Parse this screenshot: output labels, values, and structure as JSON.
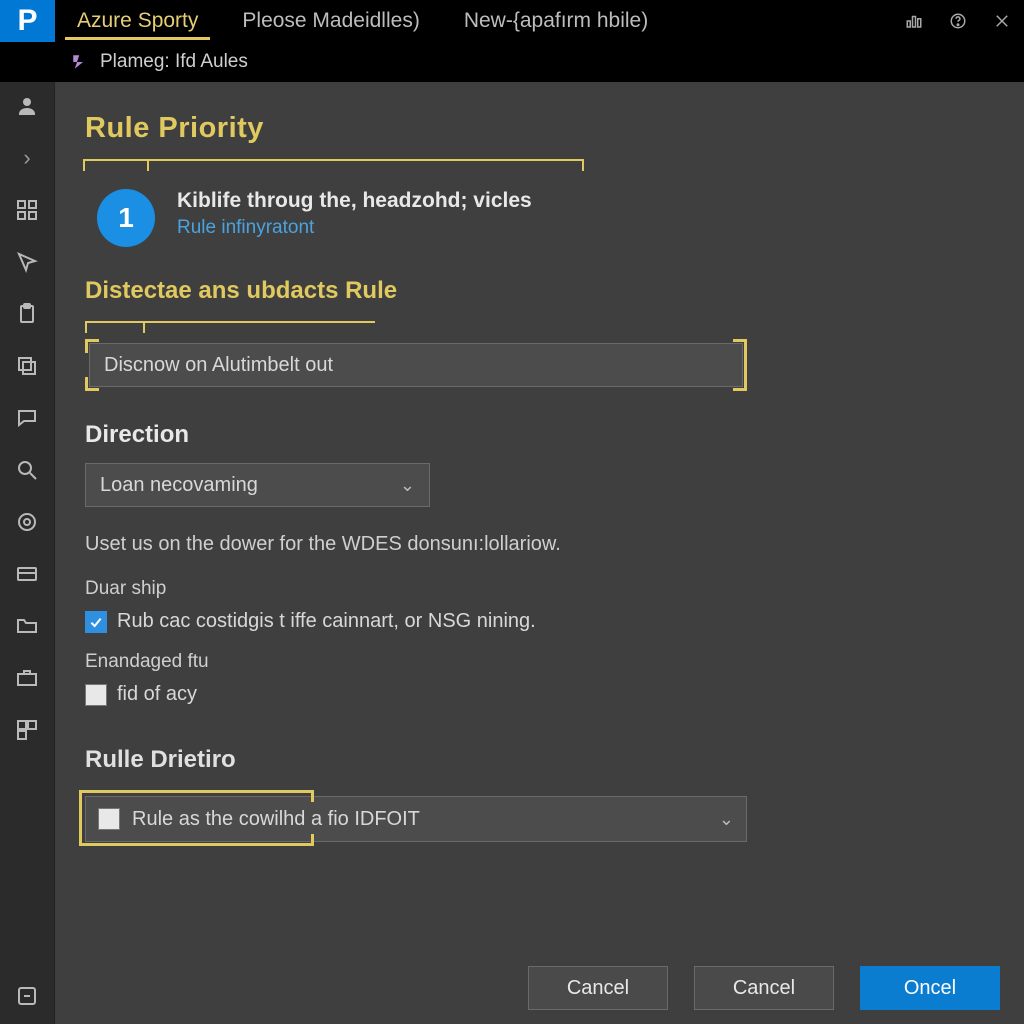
{
  "tabs": {
    "t0": "Azure Sporty",
    "t1": "Pleose Madeidlles)",
    "t2": "New-{apafırm  hbile)"
  },
  "breadcrumb": {
    "label": "Plameg: Ifd Aules"
  },
  "sections": {
    "priority_title": "Rule Priority",
    "priority_item_text": "Kiblife throug the, headzohd; vicles",
    "priority_item_link": "Rule infinyratont",
    "priority_badge": "1",
    "dist_title": "Distectae ans ubdacts Rule",
    "dist_input": "Discnow on Alutimbelt out",
    "direction_title": "Direction",
    "direction_selected": "Loan necovaming",
    "helper": "Uset us on the dower for the WDES donsunı:lollariow.",
    "group1_label": "Duar ship",
    "check1_label": "Rub cac costidgis t iffe cainnart, or NSG nining.",
    "group2_label": "Enandaged ftu",
    "check2_label": "fid of acy",
    "rule_drietiro_title": "Rulle Drietiro",
    "rule_select_text": "Rule as the cowilhd a fio IDFOIT"
  },
  "footer": {
    "cancel1": "Cancel",
    "cancel2": "Cancel",
    "ok": "Oncel"
  }
}
